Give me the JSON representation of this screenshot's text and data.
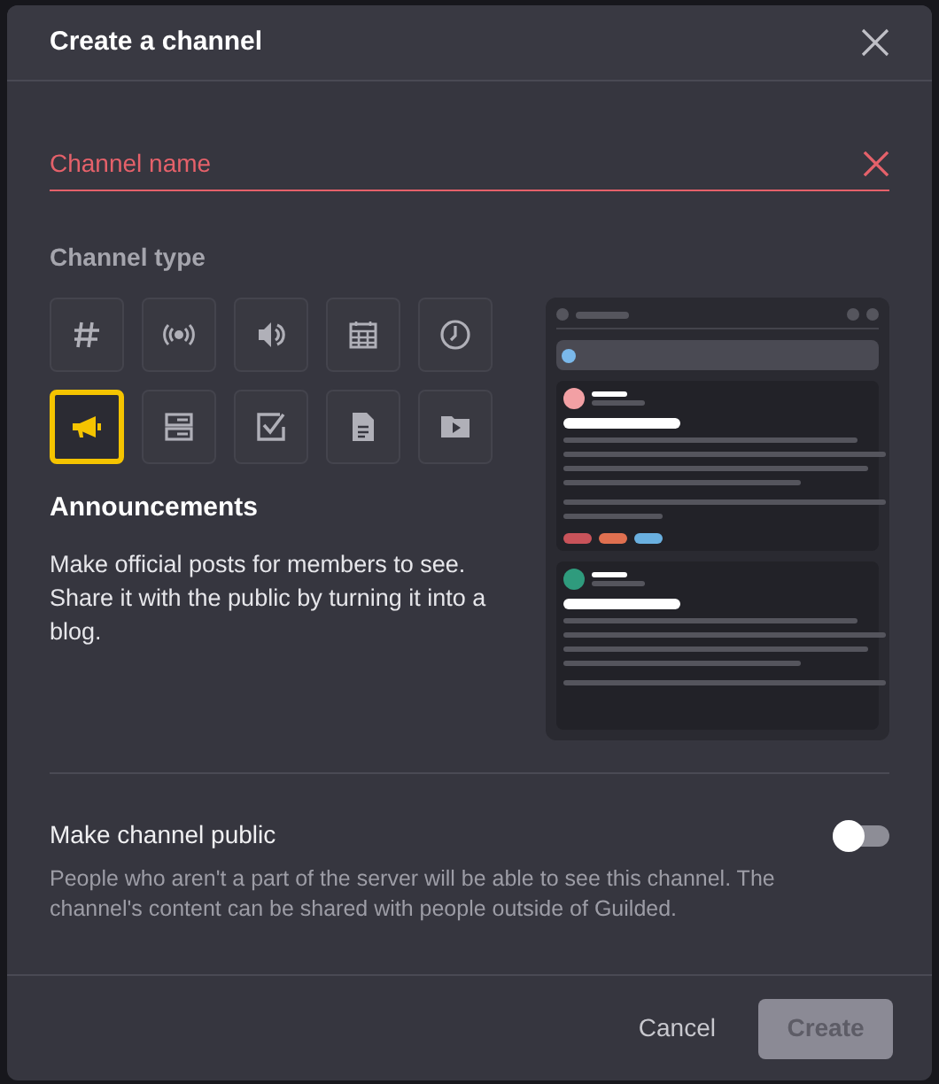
{
  "dialog": {
    "title": "Create a channel"
  },
  "name_field": {
    "placeholder": "Channel name",
    "error": true
  },
  "channel_type": {
    "label": "Channel type",
    "types": [
      {
        "kind": "chat",
        "selected": false
      },
      {
        "kind": "stream",
        "selected": false
      },
      {
        "kind": "voice",
        "selected": false
      },
      {
        "kind": "calendar",
        "selected": false
      },
      {
        "kind": "scheduling",
        "selected": false
      },
      {
        "kind": "announcements",
        "selected": true
      },
      {
        "kind": "list",
        "selected": false
      },
      {
        "kind": "tasks",
        "selected": false
      },
      {
        "kind": "docs",
        "selected": false
      },
      {
        "kind": "media",
        "selected": false
      }
    ],
    "selected_title": "Announcements",
    "selected_description": "Make official posts for members to see. Share it with the public by turning it into a blog."
  },
  "public": {
    "label": "Make channel public",
    "on": false,
    "description": "People who aren't a part of the server will be able to see this channel. The channel's content can be shared with people outside of Guilded."
  },
  "buttons": {
    "cancel": "Cancel",
    "create": {
      "label": "Create",
      "disabled": true
    }
  }
}
